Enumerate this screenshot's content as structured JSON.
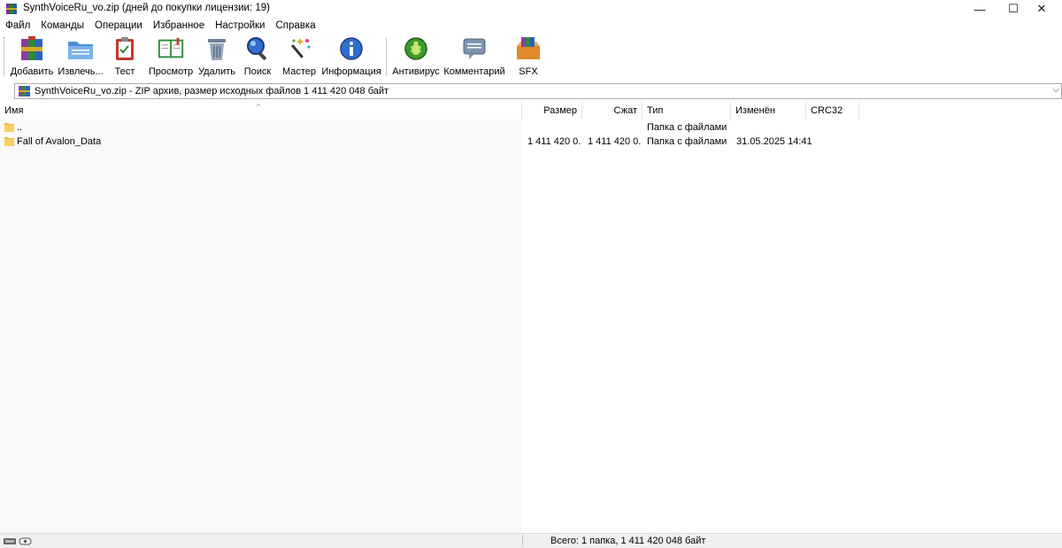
{
  "window": {
    "title": "SynthVoiceRu_vo.zip (дней до покупки лицензии: 19)",
    "min_glyph": "—",
    "max_glyph": "☐",
    "close_glyph": "✕"
  },
  "menu": [
    "Файл",
    "Команды",
    "Операции",
    "Избранное",
    "Настройки",
    "Справка"
  ],
  "toolbar": [
    {
      "label": "Добавить",
      "icon": "add-archive-icon"
    },
    {
      "label": "Извлечь...",
      "icon": "extract-folder-icon"
    },
    {
      "label": "Тест",
      "icon": "test-clipboard-icon"
    },
    {
      "label": "Просмотр",
      "icon": "view-book-icon"
    },
    {
      "label": "Удалить",
      "icon": "trash-bin-icon"
    },
    {
      "label": "Поиск",
      "icon": "magnifier-icon"
    },
    {
      "label": "Мастер",
      "icon": "magic-wand-icon"
    },
    {
      "label": "Информация",
      "icon": "info-icon"
    },
    {
      "label": "Антивирус",
      "icon": "antivirus-bug-icon"
    },
    {
      "label": "Комментарий",
      "icon": "comment-bubble-icon"
    },
    {
      "label": "SFX",
      "icon": "sfx-box-icon"
    }
  ],
  "address": {
    "text": "SynthVoiceRu_vo.zip - ZIP архив, размер исходных файлов 1 411 420 048 байт",
    "drop_glyph": "⌵"
  },
  "columns": {
    "name": "Имя",
    "size": "Размер",
    "packed": "Сжат",
    "type": "Тип",
    "modified": "Изменён",
    "crc": "CRC32",
    "sort_glyph": "^"
  },
  "rows": [
    {
      "name": "..",
      "size": "",
      "packed": "",
      "type": "Папка с файлами",
      "modified": ""
    },
    {
      "name": "Fall of Avalon_Data",
      "size": "1 411 420 0...",
      "packed": "1 411 420 0...",
      "type": "Папка с файлами",
      "modified": "31.05.2025 14:41"
    }
  ],
  "status": {
    "text": "Всего: 1 папка, 1 411 420 048 байт"
  }
}
